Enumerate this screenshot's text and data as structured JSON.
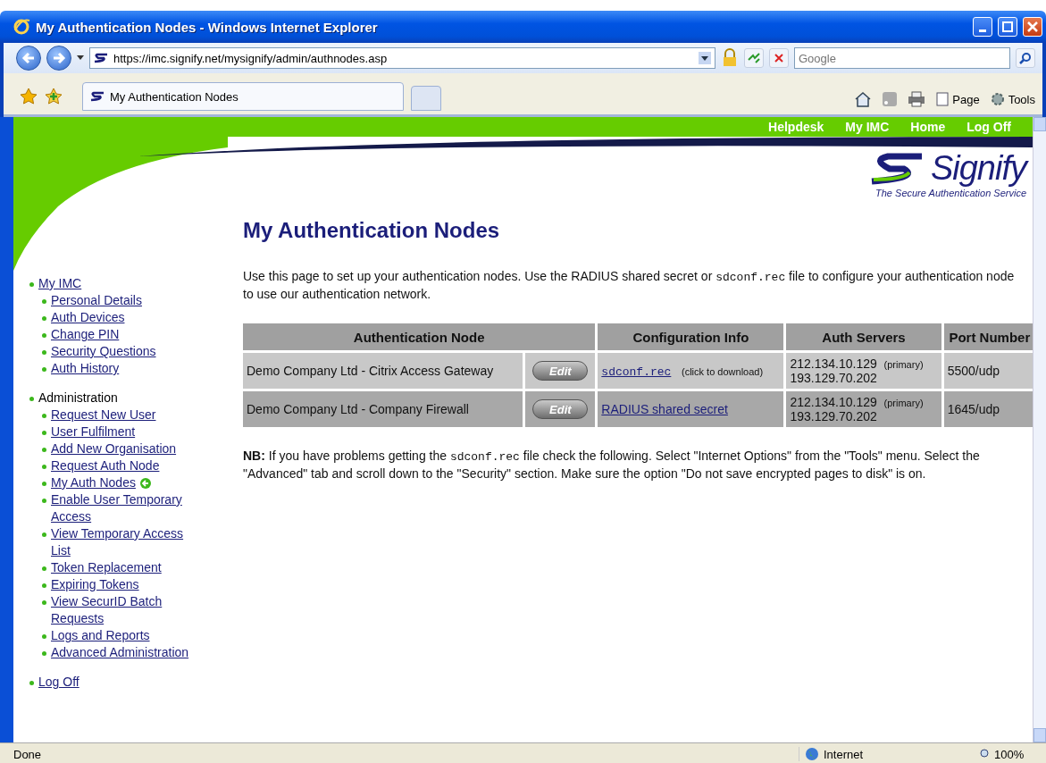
{
  "window": {
    "title": "My Authentication Nodes - Windows Internet Explorer"
  },
  "address_bar": {
    "url": "https://imc.signify.net/mysignify/admin/authnodes.asp"
  },
  "search": {
    "placeholder": "Google"
  },
  "tabs": [
    {
      "label": "My Authentication Nodes",
      "selected": true
    }
  ],
  "command_bar": [
    {
      "label": "Page"
    },
    {
      "label": "Tools"
    }
  ],
  "top_nav": [
    "Helpdesk",
    "My IMC",
    "Home",
    "Log Off"
  ],
  "logo": {
    "name": "Signify",
    "tagline": "The Secure Authentication Service"
  },
  "sidebar": {
    "items": [
      {
        "label": "My IMC",
        "kind": "link",
        "current": false,
        "children": [
          {
            "label": "Personal Details",
            "current": false
          },
          {
            "label": "Auth Devices",
            "current": false
          },
          {
            "label": "Change PIN",
            "current": false
          },
          {
            "label": "Security Questions",
            "current": false
          },
          {
            "label": "Auth History",
            "current": false
          }
        ]
      },
      {
        "label": "Administration",
        "kind": "heading",
        "current": false,
        "children": [
          {
            "label": "Request New User",
            "current": false
          },
          {
            "label": "User Fulfilment",
            "current": false
          },
          {
            "label": "Add New Organisation",
            "current": false
          },
          {
            "label": "Request Auth Node",
            "current": false
          },
          {
            "label": "My Auth Nodes",
            "current": true
          },
          {
            "label": "Enable User Temporary Access",
            "current": false
          },
          {
            "label": "View Temporary Access List",
            "current": false
          },
          {
            "label": "Token Replacement",
            "current": false
          },
          {
            "label": "Expiring Tokens",
            "current": false
          },
          {
            "label": "View SecurID Batch Requests",
            "current": false
          },
          {
            "label": "Logs and Reports",
            "current": false
          },
          {
            "label": "Advanced Administration",
            "current": false
          }
        ]
      },
      {
        "label": "Log Off",
        "kind": "link",
        "current": false
      }
    ]
  },
  "heading": "My Authentication Nodes",
  "intro": [
    {
      "kind": "text",
      "text": "Use this page to set up your authentication nodes. Use the RADIUS shared secret or "
    },
    {
      "kind": "code",
      "text": "sdconf.rec"
    },
    {
      "kind": "text",
      "text": " file to configure your authentication node to use our authentication network."
    }
  ],
  "table": {
    "columns": [
      {
        "label": "Authentication Node"
      },
      {
        "label": "Configuration Info"
      },
      {
        "label": "Auth Servers"
      },
      {
        "label": "Port Number"
      }
    ],
    "rows": [
      {
        "node": "Demo Company Ltd - Citrix Access Gateway",
        "button": "Edit",
        "config": {
          "kind": "file",
          "link": "sdconf.rec",
          "note": "(click to download)"
        },
        "servers": {
          "primary": "212.134.10.129",
          "primary_label": "(primary)",
          "secondary": "193.129.70.202"
        },
        "port": "5500/udp"
      },
      {
        "node": "Demo Company Ltd - Company Firewall",
        "button": "Edit",
        "config": {
          "kind": "text",
          "link": "RADIUS shared secret"
        },
        "servers": {
          "primary": "212.134.10.129",
          "primary_label": "(primary)",
          "secondary": "193.129.70.202"
        },
        "port": "1645/udp"
      }
    ]
  },
  "note": [
    {
      "kind": "bold",
      "text": "NB:"
    },
    {
      "kind": "text",
      "text": " If you have problems getting the "
    },
    {
      "kind": "code",
      "text": "sdconf.rec"
    },
    {
      "kind": "text",
      "text": " file check the following. Select \"Internet Options\" from the \"Tools\" menu. Select the \"Advanced\" tab and scroll down to the \"Security\" section. Make sure the option \"Do not save encrypted pages to disk\" is on."
    }
  ],
  "status_bar": {
    "text": "Done",
    "zone": "Internet",
    "zoom": "100%"
  }
}
